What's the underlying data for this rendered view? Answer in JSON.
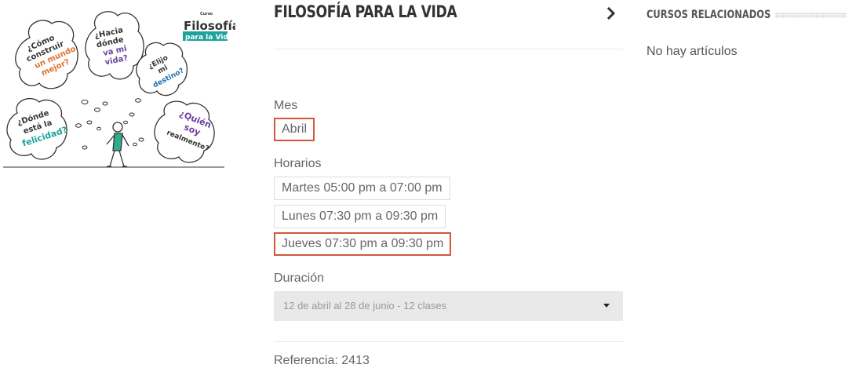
{
  "illustration": {
    "logo_small": "Curso",
    "logo_title": "Filosofía",
    "logo_banner": "para la Vida",
    "bubbles": [
      {
        "lines": [
          "¿Cómo",
          "construir",
          "un mundo",
          "mejor?"
        ]
      },
      {
        "lines": [
          "¿Hacia",
          "dónde",
          "va mi",
          "vida?"
        ]
      },
      {
        "lines": [
          "¿Elijo",
          "mi",
          "destino?"
        ]
      },
      {
        "lines": [
          "¿Dónde",
          "está la",
          "felicidad?"
        ]
      },
      {
        "lines": [
          "¿Quién",
          "soy",
          "realmente?"
        ]
      }
    ],
    "colors": {
      "orange": "#e0712b",
      "purple": "#6b3fa0",
      "teal": "#1ea39a",
      "dark": "#333333"
    }
  },
  "product": {
    "title": "FILOSOFÍA PARA LA VIDA",
    "next_icon": "chevron-right-icon"
  },
  "options": {
    "month_label": "Mes",
    "month_value": "Abril",
    "schedule_label": "Horarios",
    "schedules": [
      {
        "label": "Martes 05:00 pm a 07:00 pm",
        "selected": false
      },
      {
        "label": "Lunes 07:30 pm a 09:30 pm",
        "selected": false
      },
      {
        "label": "Jueves 07:30 pm a 09:30 pm",
        "selected": true
      }
    ],
    "duration_label": "Duración",
    "duration_value": "12 de abril al 28 de junio - 12 clases"
  },
  "meta": {
    "reference": "Referencia: 2413"
  },
  "sidebar": {
    "title": "CURSOS RELACIONADOS",
    "empty_text": "No hay artículos"
  },
  "accent_color": "#d2573b"
}
